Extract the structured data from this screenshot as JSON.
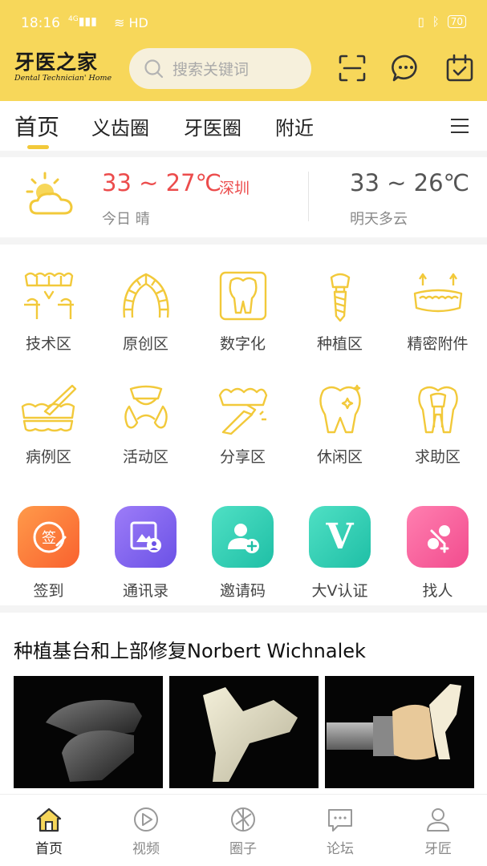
{
  "status_bar": {
    "time": "18:16",
    "signal": "4G",
    "hd": "HD",
    "battery": "70"
  },
  "header": {
    "logo_text": "牙医之家",
    "logo_subtitle": "Dental Technician' Home",
    "search_placeholder": "搜索关键词",
    "icons": [
      "scan-icon",
      "message-icon",
      "calendar-check-icon"
    ],
    "bg_color": "#f7d75a"
  },
  "tabs": [
    {
      "label": "首页",
      "active": true
    },
    {
      "label": "义齿圈",
      "active": false
    },
    {
      "label": "牙医圈",
      "active": false
    },
    {
      "label": "附近",
      "active": false
    }
  ],
  "weather": {
    "today": {
      "range": "33 ~ 27℃",
      "city": "深圳",
      "desc": "今日 晴",
      "icon": "partly-cloudy-icon"
    },
    "tomorrow": {
      "range": "33 ~ 26℃",
      "desc": "明天多云"
    }
  },
  "categories": [
    {
      "label": "技术区",
      "icon": "dental-bridge-icon"
    },
    {
      "label": "原创区",
      "icon": "dental-arch-icon"
    },
    {
      "label": "数字化",
      "icon": "digital-tooth-icon"
    },
    {
      "label": "种植区",
      "icon": "dental-implant-icon"
    },
    {
      "label": "精密附件",
      "icon": "denture-attachment-icon"
    },
    {
      "label": "病例区",
      "icon": "teeth-brush-icon"
    },
    {
      "label": "活动区",
      "icon": "partial-denture-icon"
    },
    {
      "label": "分享区",
      "icon": "veneer-icon"
    },
    {
      "label": "休闲区",
      "icon": "sparkle-tooth-icon"
    },
    {
      "label": "求助区",
      "icon": "tooth-root-icon"
    }
  ],
  "functions": [
    {
      "label": "签到",
      "icon": "sign-in-icon",
      "glyph": "签",
      "color_from": "#ff9a4a",
      "color_to": "#f9622f"
    },
    {
      "label": "通讯录",
      "icon": "contacts-icon",
      "color_from": "#9d7cf8",
      "color_to": "#6b52e6"
    },
    {
      "label": "邀请码",
      "icon": "invite-user-icon",
      "color_from": "#4fe0c4",
      "color_to": "#1fbfa6"
    },
    {
      "label": "大V认证",
      "icon": "v-verify-icon",
      "glyph": "V",
      "color_from": "#4fe0c4",
      "color_to": "#1fbfa6"
    },
    {
      "label": "找人",
      "icon": "find-people-icon",
      "color_from": "#ff7fb0",
      "color_to": "#f24c8e"
    }
  ],
  "article": {
    "title": "种植基台和上部修复Norbert Wichnalek"
  },
  "bottom_nav": [
    {
      "label": "首页",
      "icon": "home-icon",
      "active": true
    },
    {
      "label": "视频",
      "icon": "video-play-icon",
      "active": false
    },
    {
      "label": "圈子",
      "icon": "aperture-icon",
      "active": false
    },
    {
      "label": "论坛",
      "icon": "forum-icon",
      "active": false
    },
    {
      "label": "牙匠",
      "icon": "profile-icon",
      "active": false
    }
  ]
}
